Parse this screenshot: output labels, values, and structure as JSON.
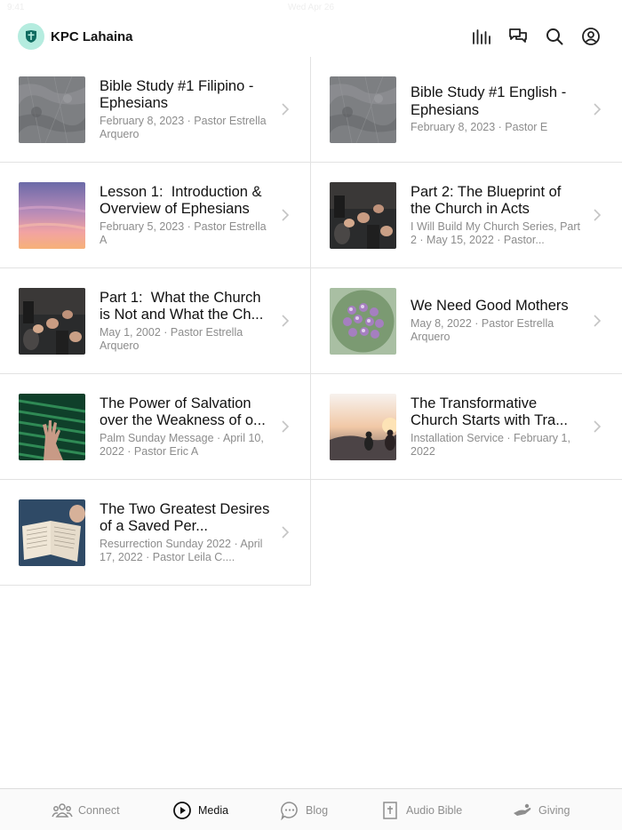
{
  "status": {
    "time": "9:41",
    "date": "Wed Apr 26"
  },
  "header": {
    "title": "KPC Lahaina",
    "actions": [
      "stats-icon",
      "chat-icon",
      "search-icon",
      "account-icon"
    ]
  },
  "media_items": [
    {
      "title": "Bible Study #1 Filipino - Ephesians",
      "meta": "February 8, 2023 · Pastor Estrella Arquero",
      "thumb": "granite"
    },
    {
      "title": "Bible Study #1 English - Ephesians",
      "meta": "February 8, 2023 · Pastor E",
      "thumb": "granite"
    },
    {
      "title": "Lesson 1:  Introduction & Overview of Ephesians",
      "meta": "February 5, 2023 · Pastor Estrella A",
      "thumb": "sunset"
    },
    {
      "title": "Part 2: The Blueprint of the Church in Acts",
      "meta": "I Will Build My Church Series, Part 2 · May 15, 2022 · Pastor...",
      "thumb": "prayer"
    },
    {
      "title": "Part 1:  What the Church is Not and What the Ch...",
      "meta": "May 1, 2002 · Pastor Estrella Arquero",
      "thumb": "prayer"
    },
    {
      "title": "We Need Good Mothers",
      "meta": "May 8, 2022 · Pastor Estrella Arquero",
      "thumb": "flowers"
    },
    {
      "title": "The Power of Salvation over the Weakness of o...",
      "meta": "Palm Sunday Message · April 10, 2022 · Pastor Eric A",
      "thumb": "palm"
    },
    {
      "title": "The Transformative Church Starts with Tra...",
      "meta": "Installation Service · February 1, 2022",
      "thumb": "hill"
    },
    {
      "title": "The Two Greatest Desires of a Saved Per...",
      "meta": "Resurrection Sunday 2022 · April 17, 2022 · Pastor Leila C....",
      "thumb": "bible"
    }
  ],
  "tabs": [
    {
      "label": "Connect",
      "icon": "people-icon",
      "active": false
    },
    {
      "label": "Media",
      "icon": "play-circle-icon",
      "active": true
    },
    {
      "label": "Blog",
      "icon": "chat-bubble-icon",
      "active": false
    },
    {
      "label": "Audio Bible",
      "icon": "bible-cross-icon",
      "active": false
    },
    {
      "label": "Giving",
      "icon": "giving-hand-icon",
      "active": false
    }
  ],
  "colors": {
    "accent": "#111111",
    "logo_bg": "#b5ecdf",
    "muted": "#8c8c8c",
    "divider": "#e2e2e2"
  }
}
